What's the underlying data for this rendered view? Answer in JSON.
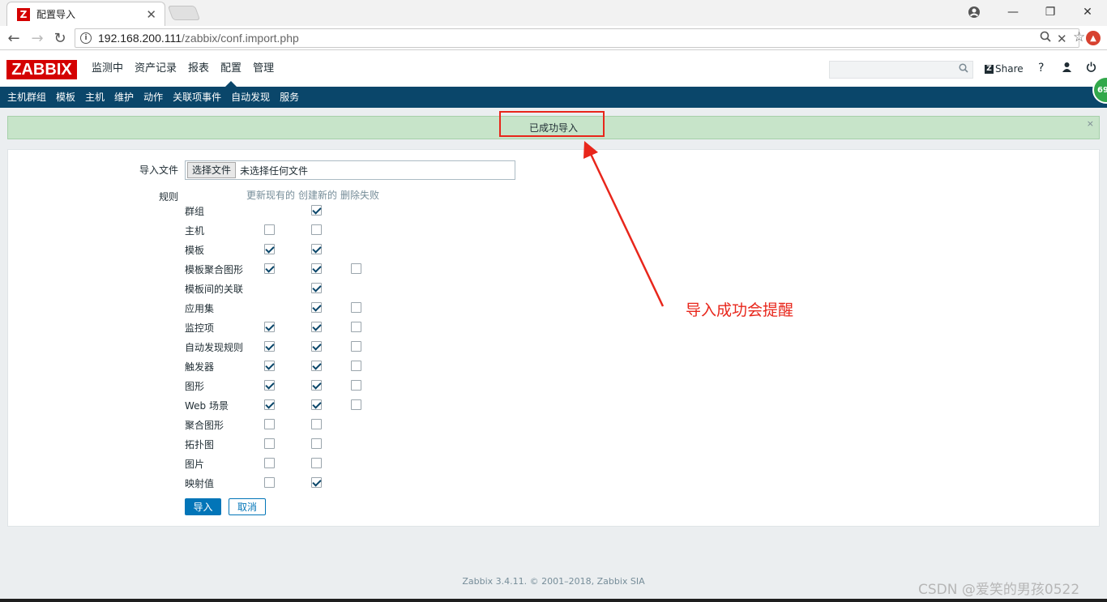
{
  "browser": {
    "tab_title": "配置导入",
    "favicon_letter": "Z",
    "url_host": "192.168.200.111",
    "url_path": "/zabbix/conf.import.php"
  },
  "header": {
    "logo": "ZABBIX",
    "menu": [
      "监测中",
      "资产记录",
      "报表",
      "配置",
      "管理"
    ],
    "selected_menu": "配置",
    "share_label": "Share",
    "help_label": "?"
  },
  "submenu": [
    "主机群组",
    "模板",
    "主机",
    "维护",
    "动作",
    "关联项事件",
    "自动发现",
    "服务"
  ],
  "message": {
    "text": "已成功导入",
    "close": "×"
  },
  "form": {
    "file_label": "导入文件",
    "file_button": "选择文件",
    "file_status": "未选择任何文件",
    "rules_label": "规则",
    "columns": [
      "更新现有的",
      "创建新的",
      "删除失败"
    ],
    "rules": [
      {
        "name": "群组",
        "update": null,
        "create": true,
        "delete": null
      },
      {
        "name": "主机",
        "update": false,
        "create": false,
        "delete": null
      },
      {
        "name": "模板",
        "update": true,
        "create": true,
        "delete": null
      },
      {
        "name": "模板聚合图形",
        "update": true,
        "create": true,
        "delete": false
      },
      {
        "name": "模板间的关联",
        "update": null,
        "create": true,
        "delete": null
      },
      {
        "name": "应用集",
        "update": null,
        "create": true,
        "delete": false
      },
      {
        "name": "监控项",
        "update": true,
        "create": true,
        "delete": false
      },
      {
        "name": "自动发现规则",
        "update": true,
        "create": true,
        "delete": false
      },
      {
        "name": "触发器",
        "update": true,
        "create": true,
        "delete": false
      },
      {
        "name": "图形",
        "update": true,
        "create": true,
        "delete": false
      },
      {
        "name": "Web 场景",
        "update": true,
        "create": true,
        "delete": false
      },
      {
        "name": "聚合图形",
        "update": false,
        "create": false,
        "delete": null
      },
      {
        "name": "拓扑图",
        "update": false,
        "create": false,
        "delete": null
      },
      {
        "name": "图片",
        "update": false,
        "create": false,
        "delete": null
      },
      {
        "name": "映射值",
        "update": false,
        "create": true,
        "delete": null
      }
    ],
    "import_button": "导入",
    "cancel_button": "取消"
  },
  "annotation": "导入成功会提醒",
  "footer": "Zabbix 3.4.11. © 2001–2018, Zabbix SIA",
  "watermark": "CSDN @爱笑的男孩0522",
  "badge": "69"
}
